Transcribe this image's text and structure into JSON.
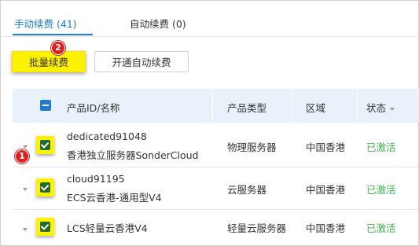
{
  "tabs": [
    {
      "label": "手动续费 (41)",
      "active": true
    },
    {
      "label": "自动续费 (0)",
      "active": false
    }
  ],
  "toolbar": {
    "batch_renew_label": "批量续费",
    "enable_auto_renew_label": "开通自动续费"
  },
  "annotations": [
    "1",
    "2"
  ],
  "table": {
    "headers": {
      "product": "产品ID/名称",
      "type": "产品类型",
      "region": "区域",
      "status": "状态"
    },
    "rows": [
      {
        "id": "dedicated91048",
        "name": "香港独立服务器SonderCloud",
        "type": "物理服务器",
        "region": "中国香港",
        "status": "已激活",
        "checked": true
      },
      {
        "id": "cloud91195",
        "name": "ECS云香港-通用型V4",
        "type": "云服务器",
        "region": "中国香港",
        "status": "已激活",
        "checked": true
      },
      {
        "id": "",
        "name": "LCS轻量云香港V4",
        "type": "轻量云服务器",
        "region": "中国香港",
        "status": "已激活",
        "checked": true
      }
    ]
  },
  "colors": {
    "accent": "#1f7bd8",
    "highlight": "#fff200",
    "status_active": "#3cb34a",
    "badge": "#e02020"
  }
}
